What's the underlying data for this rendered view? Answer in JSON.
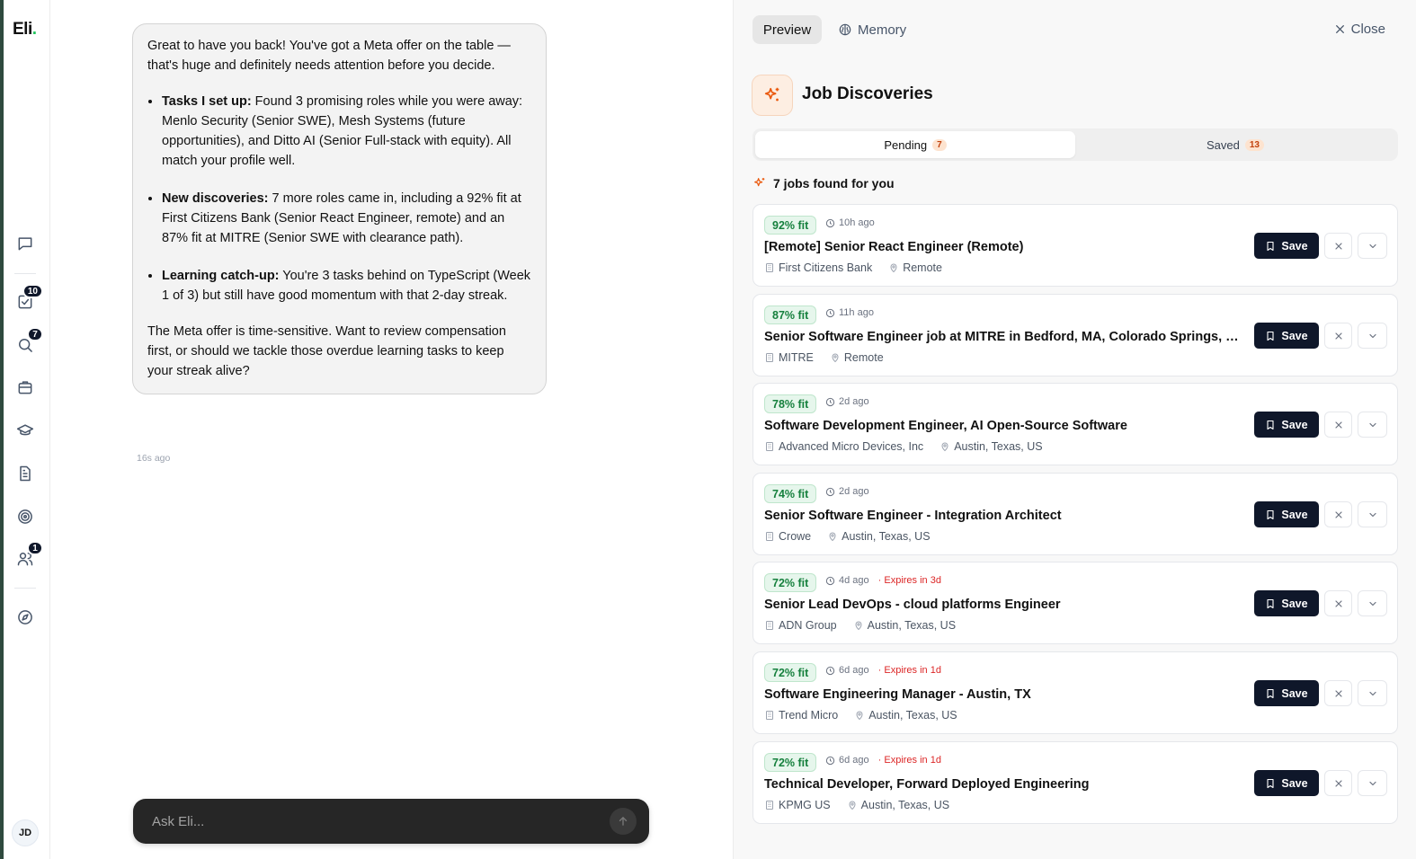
{
  "app": {
    "logo": "Eli",
    "logo_dot": "."
  },
  "rail": {
    "badges": {
      "tasks": "10",
      "search": "7",
      "people": "1"
    },
    "avatar_initials": "JD"
  },
  "chat": {
    "intro": "Great to have you back! You've got a Meta offer on the table — that's huge and definitely needs attention before you decide.",
    "bullets": [
      {
        "label": "Tasks I set up:",
        "text": " Found 3 promising roles while you were away: Menlo Security (Senior SWE), Mesh Systems (future opportunities), and Ditto AI (Senior Full-stack with equity). All match your profile well."
      },
      {
        "label": "New discoveries:",
        "text": " 7 more roles came in, including a 92% fit at First Citizens Bank (Senior React Engineer, remote) and an 87% fit at MITRE (Senior SWE with clearance path)."
      },
      {
        "label": "Learning catch-up:",
        "text": " You're 3 tasks behind on TypeScript (Week 1 of 3) but still have good momentum with that 2-day streak."
      }
    ],
    "outro": "The Meta offer is time-sensitive. Want to review compensation first, or should we tackle those overdue learning tasks to keep your streak alive?",
    "timestamp": "16s ago",
    "composer_placeholder": "Ask Eli..."
  },
  "panel": {
    "tab_preview": "Preview",
    "tab_memory": "Memory",
    "close_label": "Close",
    "title": "Job Discoveries",
    "seg_pending": "Pending",
    "seg_pending_count": "7",
    "seg_saved": "Saved",
    "seg_saved_count": "13",
    "found_text": "7 jobs found for you",
    "save_label": "Save",
    "jobs": [
      {
        "fit": "92% fit",
        "time": "10h ago",
        "expires": "",
        "title": "[Remote] Senior React Engineer (Remote)",
        "company": "First Citizens Bank",
        "location": "Remote"
      },
      {
        "fit": "87% fit",
        "time": "11h ago",
        "expires": "",
        "title": "Senior Software Engineer job at MITRE in Bedford, MA, Colorado Springs, CO, McLean, VA",
        "company": "MITRE",
        "location": "Remote"
      },
      {
        "fit": "78% fit",
        "time": "2d ago",
        "expires": "",
        "title": "Software Development Engineer, AI Open-Source Software",
        "company": "Advanced Micro Devices, Inc",
        "location": "Austin, Texas, US"
      },
      {
        "fit": "74% fit",
        "time": "2d ago",
        "expires": "",
        "title": "Senior Software Engineer - Integration Architect",
        "company": "Crowe",
        "location": "Austin, Texas, US"
      },
      {
        "fit": "72% fit",
        "time": "4d ago",
        "expires": "· Expires in 3d",
        "title": "Senior Lead DevOps - cloud platforms Engineer",
        "company": "ADN Group",
        "location": "Austin, Texas, US"
      },
      {
        "fit": "72% fit",
        "time": "6d ago",
        "expires": "· Expires in 1d",
        "title": "Software Engineering Manager - Austin, TX",
        "company": "Trend Micro",
        "location": "Austin, Texas, US"
      },
      {
        "fit": "72% fit",
        "time": "6d ago",
        "expires": "· Expires in 1d",
        "title": "Technical Developer, Forward Deployed Engineering",
        "company": "KPMG US",
        "location": "Austin, Texas, US"
      }
    ]
  },
  "colors": {
    "accent_orange": "#ea580c",
    "fit_green": "#15803d",
    "expires_red": "#dc2626",
    "save_dark": "#0f172a"
  }
}
